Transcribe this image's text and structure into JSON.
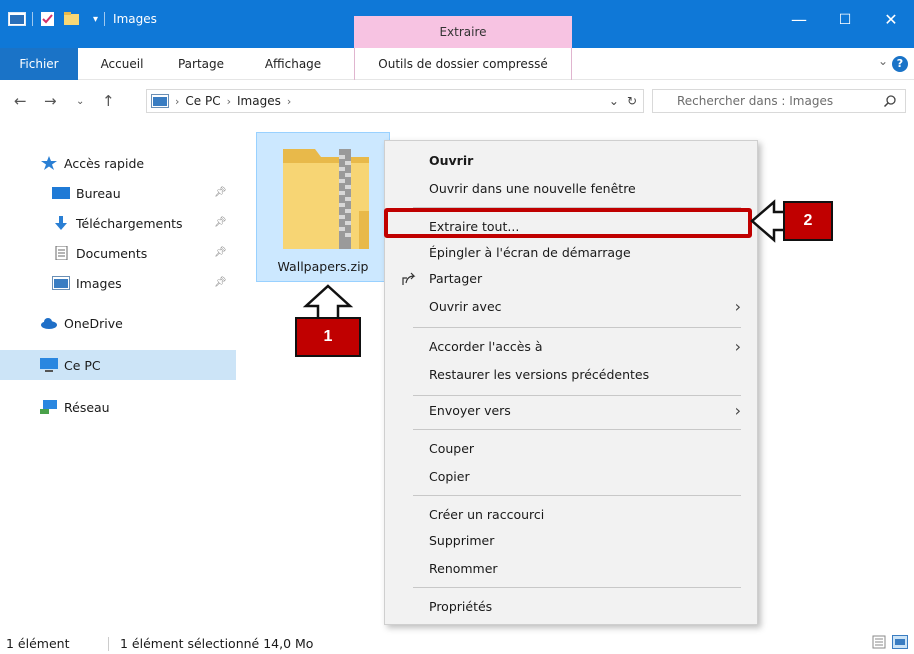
{
  "window": {
    "title": "Images",
    "contextual_tab_group": "Extraire",
    "minimize": "—",
    "maximize": "☐",
    "close": "✕"
  },
  "ribbon": {
    "tabs": [
      {
        "label": "Fichier"
      },
      {
        "label": "Accueil"
      },
      {
        "label": "Partage"
      },
      {
        "label": "Affichage"
      },
      {
        "label": "Outils de dossier compressé"
      }
    ],
    "help": "?",
    "expand": "⌄"
  },
  "address": {
    "breadcrumb": [
      "Ce PC",
      "Images"
    ],
    "search_placeholder": "Rechercher dans : Images"
  },
  "navigation": {
    "quick_access": "Accès rapide",
    "items": [
      {
        "label": "Bureau"
      },
      {
        "label": "Téléchargements"
      },
      {
        "label": "Documents"
      },
      {
        "label": "Images"
      }
    ],
    "onedrive": "OneDrive",
    "this_pc": "Ce PC",
    "network": "Réseau"
  },
  "content": {
    "file_name": "Wallpapers.zip"
  },
  "context_menu": {
    "items": [
      "Ouvrir",
      "Ouvrir dans une nouvelle fenêtre",
      "Extraire tout...",
      "Épingler à l'écran de démarrage",
      "Partager",
      "Ouvrir avec",
      "Accorder l'accès à",
      "Restaurer les versions précédentes",
      "Envoyer vers",
      "Couper",
      "Copier",
      "Créer un raccourci",
      "Supprimer",
      "Renommer",
      "Propriétés"
    ],
    "submenu_arrow": "›"
  },
  "callouts": {
    "one": "1",
    "two": "2"
  },
  "status_bar": {
    "count": "1 élément",
    "selection": "1 élément sélectionné 14,0 Mo"
  },
  "colors": {
    "titlebar": "#0f78d7",
    "contextual_tab": "#f7c3e2",
    "selection": "#cce8ff",
    "callout": "#c00000"
  }
}
